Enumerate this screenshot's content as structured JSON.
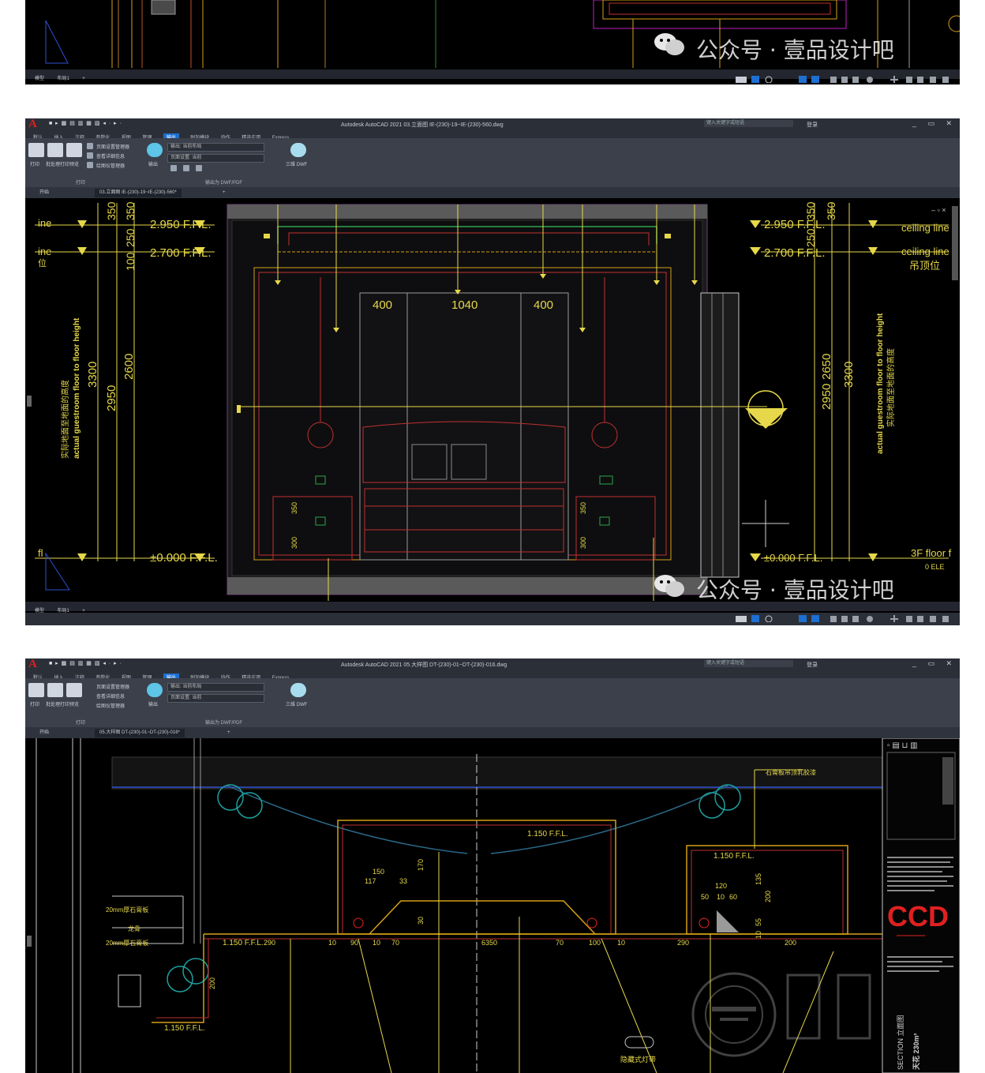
{
  "app": {
    "logo": "A",
    "quick_access": "■ ▸ ▩ ▤ ▥ ▦ ▧ ◂ · ▸ ·",
    "title_2": "Autodesk AutoCAD 2021   03.立面图 IE-(230)-19~IE-(230)-560.dwg",
    "title_3": "Autodesk AutoCAD 2021   05.大样图 DT-(230)-01~DT-(230)-016.dwg",
    "search_placeholder": "键入关键字或短语",
    "login": "登录",
    "window_controls": "_ ▭ ✕"
  },
  "menu": [
    "默认",
    "插入",
    "注释",
    "参数化",
    "视图",
    "管理",
    "输出",
    "附加模块",
    "协作",
    "精选应用",
    "Express"
  ],
  "menu_active_index": 6,
  "ribbon": {
    "buttons": [
      "打印",
      "批处理打印",
      "预览",
      "输出"
    ],
    "list_items": [
      "页面设置管理器",
      "查看详细信息",
      "绘图仪管理器"
    ],
    "field1": "输出: 当前布局",
    "field2": "页面设置: 当前",
    "export_3d": "三维 DWF",
    "panel_print": "打印",
    "panel_export": "输出为 DWF/PDF"
  },
  "doc_tabs": {
    "start": "开始",
    "tab_2": "03.立面图 IE-(230)-19~IE-(230)-560*",
    "tab_3": "05.大样图 DT-(230)-01~DT-(230)-016*"
  },
  "layout_tabs": [
    "模型",
    "布局1"
  ],
  "watermark": "公众号 · 壹品设计吧",
  "elevation": {
    "left_labels": {
      "ceiling1": "ine",
      "ceiling2": "ine",
      "floor": "fl",
      "ceiling_cn": "位"
    },
    "right_labels": {
      "ceiling1": "ceiling line",
      "ceiling2": "ceiling line",
      "ceiling_cn": "吊顶位",
      "floor": "3F floor f",
      "floor_sub": "0 ELE"
    },
    "levels_left": [
      "2.950 F.F.L.",
      "2.700 F.F.L.",
      "±0.000 F.F.L."
    ],
    "levels_right": [
      "2.950 F.F.L.",
      "2.700 F.F.L.",
      "±0.000 F.F.L."
    ],
    "top_dims": [
      "350",
      "350",
      "350",
      "350"
    ],
    "dims_left_small": [
      "250",
      "100"
    ],
    "dims_right_small": [
      "250"
    ],
    "vertical_dims_left": [
      "3300",
      "2950",
      "2600"
    ],
    "vertical_dims_right": [
      "3300",
      "2950",
      "2650"
    ],
    "vertical_note_cn": "实际地面至地面的高度",
    "vertical_note_en": "actual guestroom floor to floor height",
    "width_dims": [
      "400",
      "1040",
      "400"
    ],
    "small_dims": [
      "350",
      "300",
      "350",
      "300"
    ]
  },
  "detail": {
    "levels": [
      "1.150 F.F.L.",
      "1.150 F.F.L.",
      "1.150 F.F.L.",
      "1.150 F.F.L."
    ],
    "dims_bottom": [
      "290",
      "10",
      "90",
      "10",
      "70",
      "6350",
      "70",
      "100",
      "10",
      "290",
      "200"
    ],
    "dims_small_left": [
      "150",
      "117",
      "33"
    ],
    "dims_small_right": [
      "120",
      "50",
      "10",
      "60"
    ],
    "dims_vertical": [
      "170",
      "30",
      "200",
      "135",
      "200",
      "55",
      "10"
    ],
    "note_top_right": "石膏板吊顶乳胶漆",
    "notes_left": [
      "20mm厚石膏板",
      "龙骨",
      "20mm厚石膏板"
    ],
    "note_bottom": "隐藏式灯带",
    "logo_ccd": "CCD",
    "section_label": "SECTION 立面图",
    "area_label": "天花 230m²"
  },
  "colors": {
    "accent_blue": "#1d6fd1",
    "brand_red": "#e02020"
  }
}
